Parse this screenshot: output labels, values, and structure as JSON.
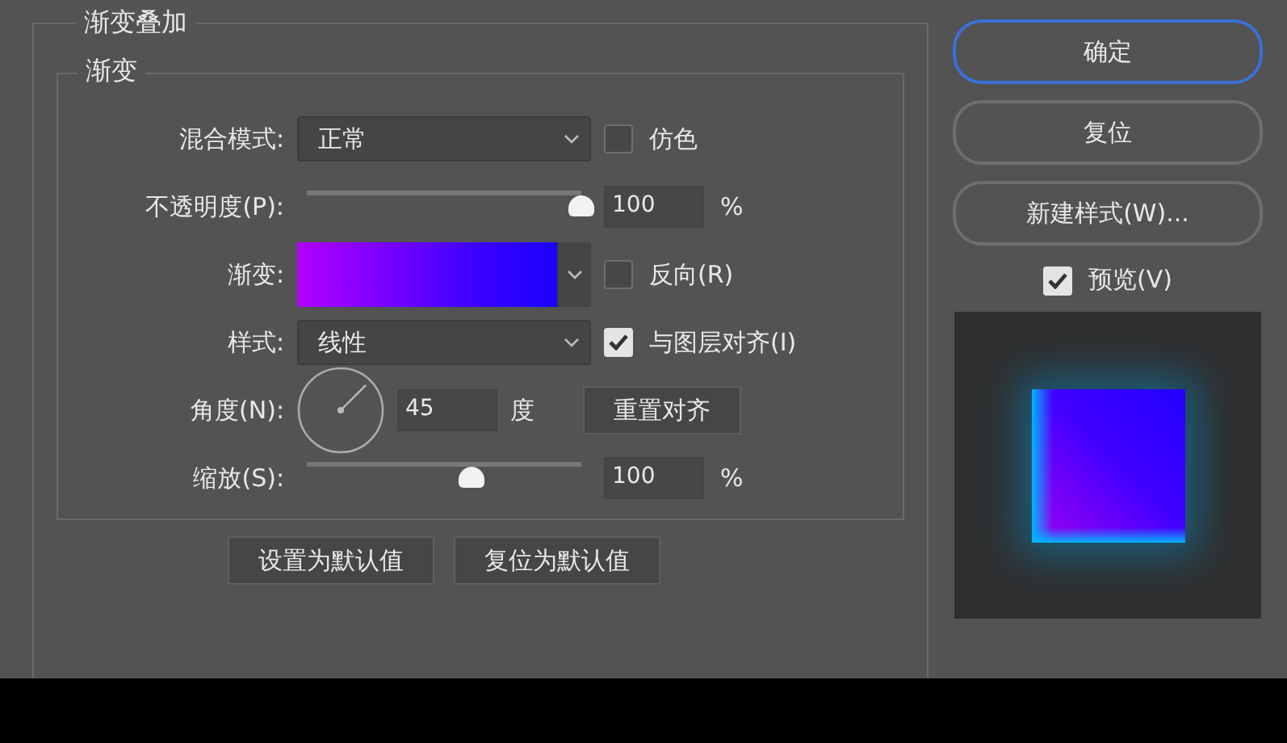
{
  "group_title": "渐变叠加",
  "gradient_section": {
    "title": "渐变",
    "blend_mode": {
      "label": "混合模式:",
      "value": "正常",
      "dither": {
        "label": "仿色",
        "checked": false
      }
    },
    "opacity": {
      "label": "不透明度(P):",
      "level": 1.0,
      "value": "100",
      "unit": "%"
    },
    "gradient": {
      "label": "渐变:",
      "reverse": {
        "label": "反向(R)",
        "checked": false
      }
    },
    "style": {
      "label": "样式:",
      "value": "线性",
      "align": {
        "label": "与图层对齐(I)",
        "checked": true
      }
    },
    "angle": {
      "label": "角度(N):",
      "value": "45",
      "unit": "度",
      "reset_button": "重置对齐"
    },
    "scale": {
      "label": "缩放(S):",
      "level": 0.6,
      "value": "100",
      "unit": "%"
    }
  },
  "default_buttons": [
    "设置为默认值",
    "复位为默认值"
  ],
  "side_buttons": [
    {
      "label": "确定",
      "focused": true
    },
    {
      "label": "复位",
      "focused": false
    },
    {
      "label": "新建样式(W)...",
      "focused": false
    }
  ],
  "preview": {
    "label": "预览(V)",
    "checked": true
  }
}
